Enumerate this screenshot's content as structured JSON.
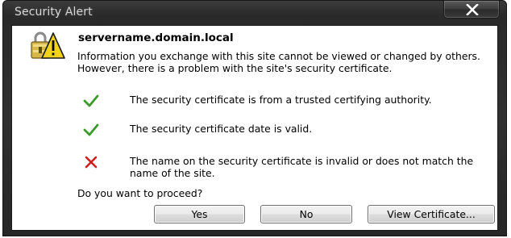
{
  "window": {
    "title": "Security Alert"
  },
  "dialog": {
    "server_name": "servername.domain.local",
    "intro_text": "Information you exchange with this site cannot be viewed or changed by others. However, there is a problem with the site's security certificate.",
    "checks": [
      {
        "status": "pass",
        "icon": "green-checkmark-icon",
        "text": "The security certificate is from a trusted certifying authority."
      },
      {
        "status": "pass",
        "icon": "green-checkmark-icon",
        "text": "The security certificate date is valid."
      },
      {
        "status": "fail",
        "icon": "red-x-icon",
        "text": "The name on the security certificate is invalid or does not match the name of the site."
      }
    ],
    "question": "Do you want to proceed?"
  },
  "buttons": {
    "yes_label": "Yes",
    "no_label": "No",
    "view_certificate_label": "View Certificate..."
  },
  "colors": {
    "pass": "#3c9a2a",
    "fail": "#d0201a",
    "warning_yellow": "#f3d21c"
  }
}
